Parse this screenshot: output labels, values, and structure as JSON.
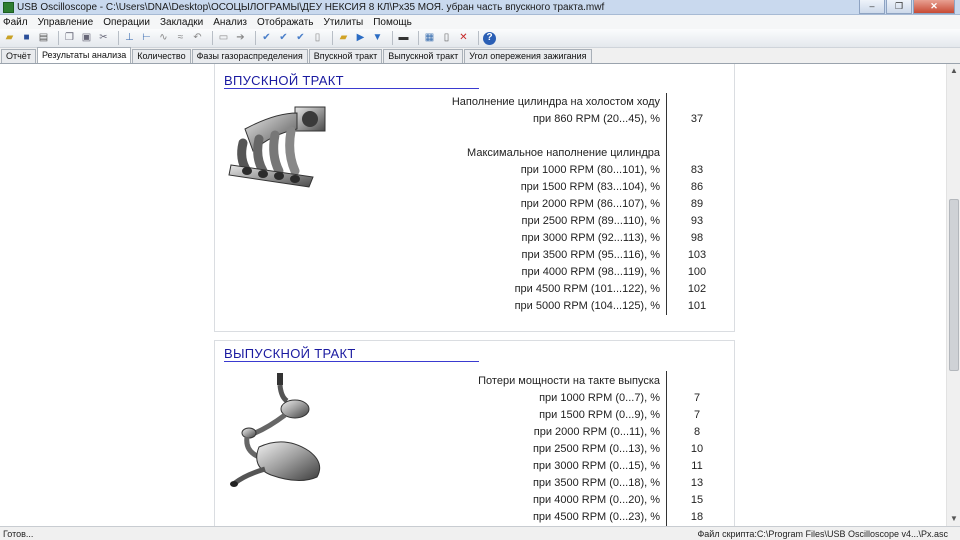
{
  "window": {
    "title": "USB Oscilloscope - C:\\Users\\DNA\\Desktop\\ОСОЦЫЛОГРАМЫ\\ДЕУ НЕКСИЯ 8 КЛ\\Рх35 МОЯ. убран часть впускного тракта.mwf",
    "buttons": [
      "–",
      "❐",
      "✕"
    ]
  },
  "menu": [
    "Файл",
    "Управление",
    "Операции",
    "Закладки",
    "Анализ",
    "Отображать",
    "Утилиты",
    "Помощь"
  ],
  "tabs": [
    "Отчёт",
    "Результаты анализа",
    "Количество",
    "Фазы газораспределения",
    "Впускной тракт",
    "Выпускной тракт",
    "Угол опережения зажигания"
  ],
  "active_tab": "Результаты анализа",
  "intake": {
    "title": "ВПУСКНОЙ ТРАКТ",
    "idle_header": "Наполнение цилиндра на холостом ходу",
    "idle_rows": [
      {
        "label": "при 860 RPM (20...45), %",
        "value": "37"
      }
    ],
    "max_header": "Максимальное наполнение цилиндра",
    "max_rows": [
      {
        "label": "при 1000 RPM (80...101), %",
        "value": "83"
      },
      {
        "label": "при 1500 RPM (83...104), %",
        "value": "86"
      },
      {
        "label": "при 2000 RPM (86...107), %",
        "value": "89"
      },
      {
        "label": "при 2500 RPM (89...110), %",
        "value": "93"
      },
      {
        "label": "при 3000 RPM (92...113), %",
        "value": "98"
      },
      {
        "label": "при 3500 RPM (95...116), %",
        "value": "103"
      },
      {
        "label": "при 4000 RPM (98...119), %",
        "value": "100"
      },
      {
        "label": "при 4500 RPM (101...122), %",
        "value": "102"
      },
      {
        "label": "при 5000 RPM (104...125), %",
        "value": "101"
      }
    ]
  },
  "exhaust": {
    "title": "ВЫПУСКНОЙ ТРАКТ",
    "header": "Потери мощности на такте выпуска",
    "rows": [
      {
        "label": "при 1000 RPM (0...7), %",
        "value": "7"
      },
      {
        "label": "при 1500 RPM (0...9), %",
        "value": "7"
      },
      {
        "label": "при 2000 RPM (0...11), %",
        "value": "8"
      },
      {
        "label": "при 2500 RPM (0...13), %",
        "value": "10"
      },
      {
        "label": "при 3000 RPM (0...15), %",
        "value": "11"
      },
      {
        "label": "при 3500 RPM (0...18), %",
        "value": "13"
      },
      {
        "label": "при 4000 RPM (0...20), %",
        "value": "15"
      },
      {
        "label": "при 4500 RPM (0...23), %",
        "value": "18"
      }
    ]
  },
  "status": {
    "left": "Готов...",
    "right": "Файл скрипта:C:\\Program Files\\USB Oscilloscope v4...\\Px.asc"
  }
}
